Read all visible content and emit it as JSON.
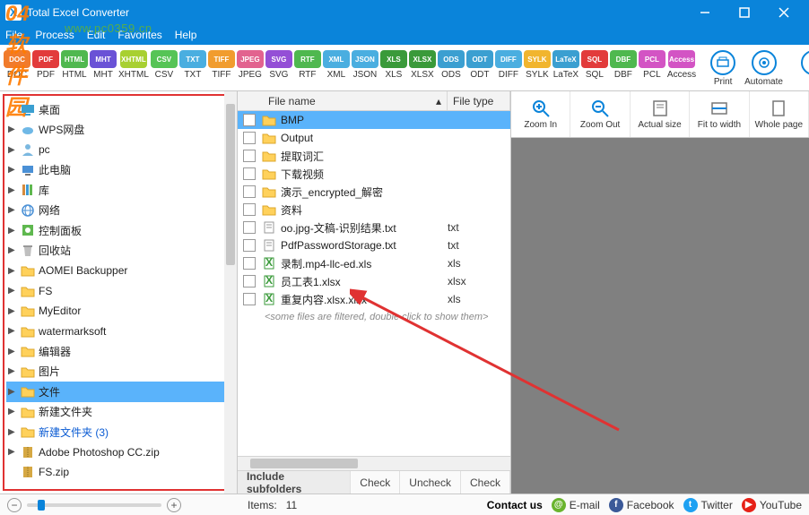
{
  "window": {
    "title": "Total Excel Converter"
  },
  "menu": {
    "file": "File",
    "process": "Process",
    "edit": "Edit",
    "favorites": "Favorites",
    "help": "Help"
  },
  "watermark": {
    "brand": "04软件园",
    "url": "www.pc0359.cn"
  },
  "formats": [
    {
      "l": "DOC",
      "c": "#f17b2b"
    },
    {
      "l": "PDF",
      "c": "#e23b3b"
    },
    {
      "l": "HTML",
      "c": "#4fb84f"
    },
    {
      "l": "MHT",
      "c": "#6a52d6"
    },
    {
      "l": "XHTML",
      "c": "#a8d031"
    },
    {
      "l": "CSV",
      "c": "#56c456"
    },
    {
      "l": "TXT",
      "c": "#4aaee0"
    },
    {
      "l": "TIFF",
      "c": "#f19c2e"
    },
    {
      "l": "JPEG",
      "c": "#e2638f"
    },
    {
      "l": "SVG",
      "c": "#944fd6"
    },
    {
      "l": "RTF",
      "c": "#4fb84f"
    },
    {
      "l": "XML",
      "c": "#4aaee0"
    },
    {
      "l": "JSON",
      "c": "#4aaee0"
    },
    {
      "l": "XLS",
      "c": "#3a9a3a"
    },
    {
      "l": "XLSX",
      "c": "#3a9a3a"
    },
    {
      "l": "ODS",
      "c": "#3b9fd1"
    },
    {
      "l": "ODT",
      "c": "#3b9fd1"
    },
    {
      "l": "DIFF",
      "c": "#4aaee0"
    },
    {
      "l": "SYLK",
      "c": "#f1b52e"
    },
    {
      "l": "LaTeX",
      "c": "#3b9fd1"
    },
    {
      "l": "SQL",
      "c": "#e23b3b"
    },
    {
      "l": "DBF",
      "c": "#4fb84f"
    },
    {
      "l": "PCL",
      "c": "#d354c4"
    },
    {
      "l": "Access",
      "c": "#d354c4"
    }
  ],
  "toolbar": {
    "print": "Print",
    "automate": "Automate",
    "reg": "R"
  },
  "tree": [
    {
      "t": "桌面",
      "icon": "desktop",
      "arrow": "",
      "cls": ""
    },
    {
      "t": "WPS网盘",
      "icon": "cloud",
      "arrow": "▶"
    },
    {
      "t": "pc",
      "icon": "user",
      "arrow": "▶"
    },
    {
      "t": "此电脑",
      "icon": "pc",
      "arrow": "▶"
    },
    {
      "t": "库",
      "icon": "lib",
      "arrow": "▶"
    },
    {
      "t": "网络",
      "icon": "net",
      "arrow": "▶"
    },
    {
      "t": "控制面板",
      "icon": "cpl",
      "arrow": "▶"
    },
    {
      "t": "回收站",
      "icon": "bin",
      "arrow": "▶"
    },
    {
      "t": "AOMEI Backupper",
      "icon": "folder",
      "arrow": "▶"
    },
    {
      "t": "FS",
      "icon": "folder",
      "arrow": "▶"
    },
    {
      "t": "MyEditor",
      "icon": "folder",
      "arrow": "▶"
    },
    {
      "t": "watermarksoft",
      "icon": "folder",
      "arrow": "▶"
    },
    {
      "t": "编辑器",
      "icon": "folder",
      "arrow": "▶"
    },
    {
      "t": "图片",
      "icon": "folder",
      "arrow": "▶"
    },
    {
      "t": "文件",
      "icon": "folder",
      "arrow": "▶",
      "sel": true
    },
    {
      "t": "新建文件夹",
      "icon": "folder",
      "arrow": "▶"
    },
    {
      "t": "新建文件夹 (3)",
      "icon": "folder",
      "arrow": "▶",
      "blue": true
    },
    {
      "t": "Adobe Photoshop CC.zip",
      "icon": "zip",
      "arrow": "▶"
    },
    {
      "t": "FS.zip",
      "icon": "zip",
      "arrow": ""
    }
  ],
  "file_header": {
    "name": "File name",
    "type": "File type"
  },
  "files": [
    {
      "n": "BMP",
      "t": "",
      "i": "folder",
      "sel": true
    },
    {
      "n": "Output",
      "t": "",
      "i": "folder"
    },
    {
      "n": "提取词汇",
      "t": "",
      "i": "folder"
    },
    {
      "n": "下载视频",
      "t": "",
      "i": "folder"
    },
    {
      "n": "演示_encrypted_解密",
      "t": "",
      "i": "folder"
    },
    {
      "n": "资料",
      "t": "",
      "i": "folder"
    },
    {
      "n": "oo.jpg-文稿-识别结果.txt",
      "t": "txt",
      "i": "txt"
    },
    {
      "n": "PdfPasswordStorage.txt",
      "t": "txt",
      "i": "txt"
    },
    {
      "n": "录制.mp4-llc-ed.xls",
      "t": "xls",
      "i": "xls"
    },
    {
      "n": "员工表1.xlsx",
      "t": "xlsx",
      "i": "xls"
    },
    {
      "n": "重复内容.xlsx.xlsx",
      "t": "xls",
      "i": "xls"
    }
  ],
  "filter_msg": "<some files are filtered, double click to show them>",
  "tabs": {
    "include": "Include subfolders",
    "check": "Check",
    "uncheck": "Uncheck",
    "checkfilter": "Check"
  },
  "right_tools": {
    "zoomin": "Zoom In",
    "zoomout": "Zoom Out",
    "actual": "Actual size",
    "fit": "Fit to width",
    "whole": "Whole page"
  },
  "status": {
    "items_label": "Items:",
    "items_count": "11",
    "contact": "Contact us",
    "email": "E-mail",
    "fb": "Facebook",
    "tw": "Twitter",
    "yt": "YouTube"
  }
}
